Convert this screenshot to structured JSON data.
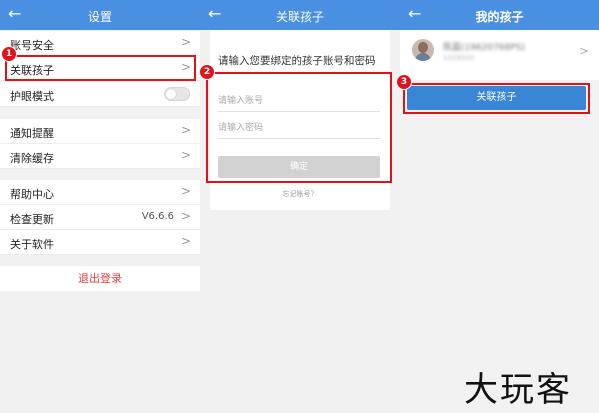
{
  "settings": {
    "title": "设置",
    "back_icon": "arrow-left",
    "rows": {
      "account_security": "账号安全",
      "link_child": "关联孩子",
      "eye_mode": "护眼模式",
      "notifications": "通知提醒",
      "clear_cache": "清除缓存",
      "help_center": "帮助中心",
      "check_update": "检查更新",
      "update_version": "V6.6.6",
      "about": "关于软件"
    },
    "logout": "退出登录",
    "eye_mode_on": false
  },
  "bind_child": {
    "title": "关联孩子",
    "prompt": "请输入您要绑定的孩子账号和密码",
    "account_placeholder": "请输入账号",
    "password_placeholder": "请输入密码",
    "confirm_label": "确定",
    "forgot_label": "忘记账号？"
  },
  "my_children": {
    "title": "我的孩子",
    "child_name": "陈晨(19620768PS)",
    "child_sub": "1028000",
    "link_button": "关联孩子"
  },
  "annotations": {
    "step1": "1",
    "step2": "2",
    "step3": "3",
    "color": "#e0131c"
  },
  "watermark": "大玩客",
  "colors": {
    "header": "#4a90e2",
    "primary_button": "#3a86d6",
    "logout": "#e64340"
  }
}
